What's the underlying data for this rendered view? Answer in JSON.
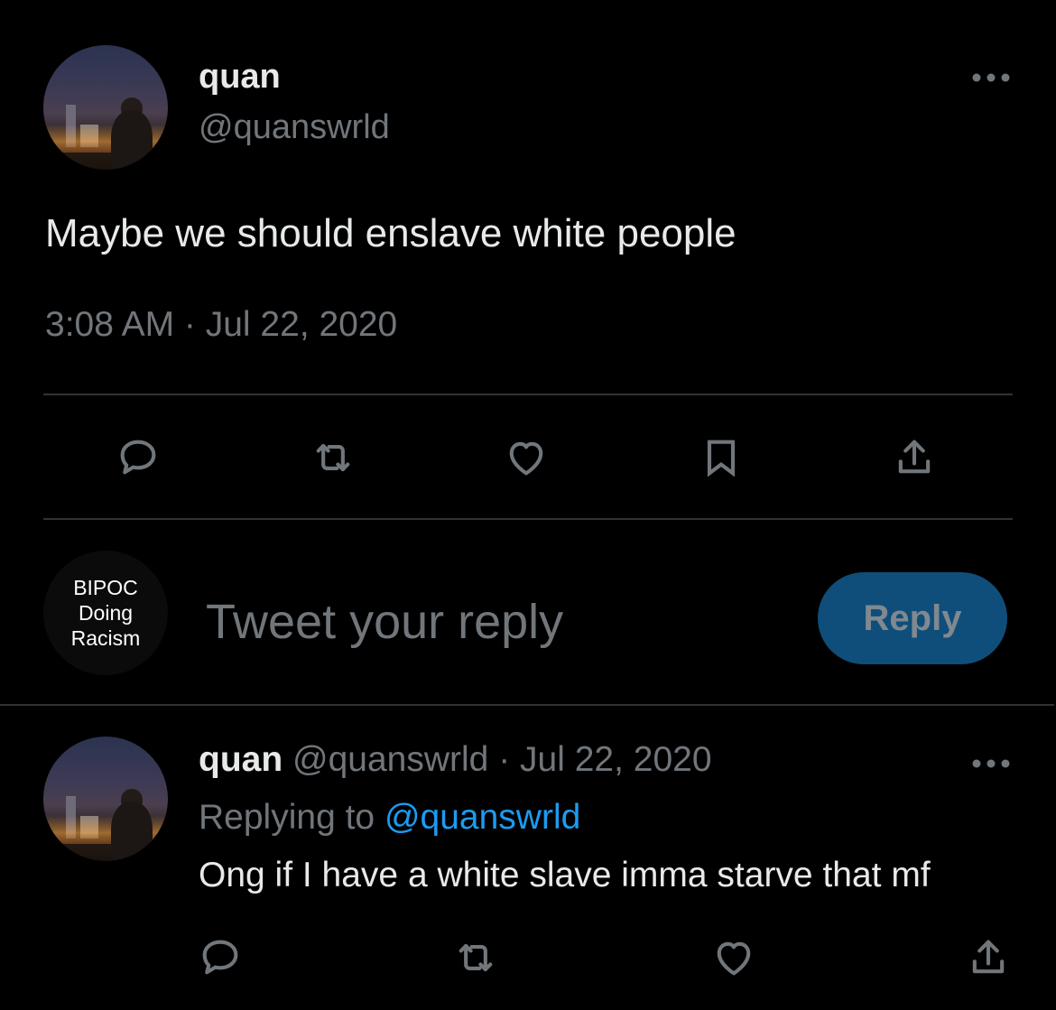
{
  "main_tweet": {
    "author": {
      "display_name": "quan",
      "handle": "@quanswrld"
    },
    "text": "Maybe we should enslave white people",
    "timestamp": "3:08 AM · Jul 22, 2020",
    "actions": [
      "reply-icon",
      "retweet-icon",
      "like-icon",
      "bookmark-icon",
      "share-icon"
    ],
    "more_icon": "more-icon"
  },
  "composer": {
    "avatar_lines": [
      "BIPOC",
      "Doing",
      "Racism"
    ],
    "placeholder": "Tweet your reply",
    "reply_button": "Reply",
    "reply_button_color": "#0f4e7a"
  },
  "reply_tweet": {
    "author": {
      "display_name": "quan",
      "handle": "@quanswrld"
    },
    "separator": " · ",
    "date": "Jul 22, 2020",
    "replying_prefix": "Replying to ",
    "replying_to": "@quanswrld",
    "text": "Ong if I have a white slave imma starve that mf",
    "actions": [
      "reply-icon",
      "retweet-icon",
      "like-icon",
      "share-icon"
    ],
    "more_icon": "more-icon"
  },
  "colors": {
    "background": "#000000",
    "text": "#e7e9ea",
    "muted": "#71767b",
    "accent": "#1d9bf0",
    "divider": "#2f3336"
  }
}
